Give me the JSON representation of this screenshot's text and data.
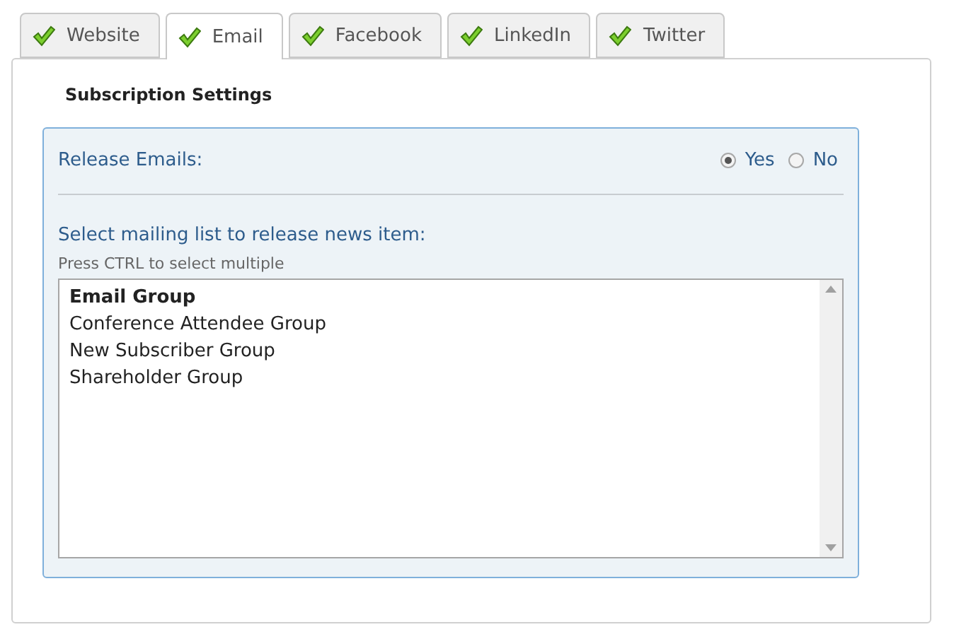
{
  "tabs": [
    {
      "label": "Website",
      "checked": true,
      "selected": false
    },
    {
      "label": "Email",
      "checked": true,
      "selected": true
    },
    {
      "label": "Facebook",
      "checked": true,
      "selected": false
    },
    {
      "label": "LinkedIn",
      "checked": true,
      "selected": false
    },
    {
      "label": "Twitter",
      "checked": true,
      "selected": false
    }
  ],
  "section_title": "Subscription Settings",
  "release_emails": {
    "label": "Release Emails:",
    "options": [
      {
        "label": "Yes",
        "selected": true
      },
      {
        "label": "No",
        "selected": false
      }
    ]
  },
  "mailing_list": {
    "label": "Select mailing list to release news item:",
    "hint": "Press CTRL to select multiple",
    "items": [
      {
        "kind": "group",
        "label": "Email Group"
      },
      {
        "kind": "option",
        "label": "Conference Attendee Group"
      },
      {
        "kind": "option",
        "label": "New Subscriber Group"
      },
      {
        "kind": "option",
        "label": "Shareholder Group"
      }
    ]
  }
}
